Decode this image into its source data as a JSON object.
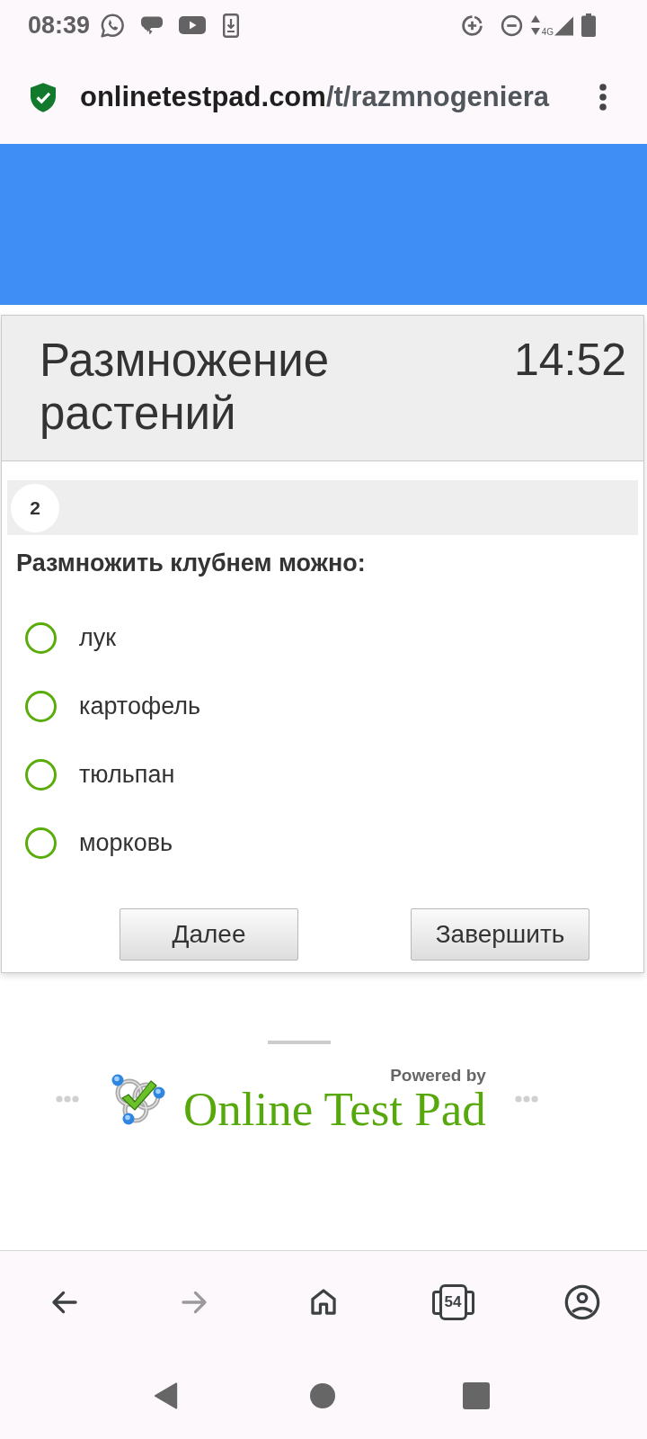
{
  "status_bar": {
    "time": "08:39",
    "network": "4G"
  },
  "address_bar": {
    "host": "onlinetestpad.com",
    "path": "/t/razmnogeniera"
  },
  "test": {
    "title": "Размножение растений",
    "timer": "14:52"
  },
  "question": {
    "number": "2",
    "text": "Размножить клубнем можно:",
    "options": [
      {
        "label": "лук",
        "selected": false
      },
      {
        "label": "картофель",
        "selected": false
      },
      {
        "label": "тюльпан",
        "selected": false
      },
      {
        "label": "морковь",
        "selected": false
      }
    ]
  },
  "buttons": [
    {
      "label": "Далее"
    },
    {
      "label": "Завершить"
    }
  ],
  "footer": {
    "powered_by": "Powered by",
    "brand": "Online Test Pad"
  },
  "browser_nav": [
    {
      "kind": "back",
      "disabled": false
    },
    {
      "kind": "forward",
      "disabled": true
    },
    {
      "kind": "home",
      "disabled": false
    },
    {
      "kind": "tabs",
      "disabled": false,
      "count": "54"
    },
    {
      "kind": "account",
      "disabled": false
    }
  ]
}
